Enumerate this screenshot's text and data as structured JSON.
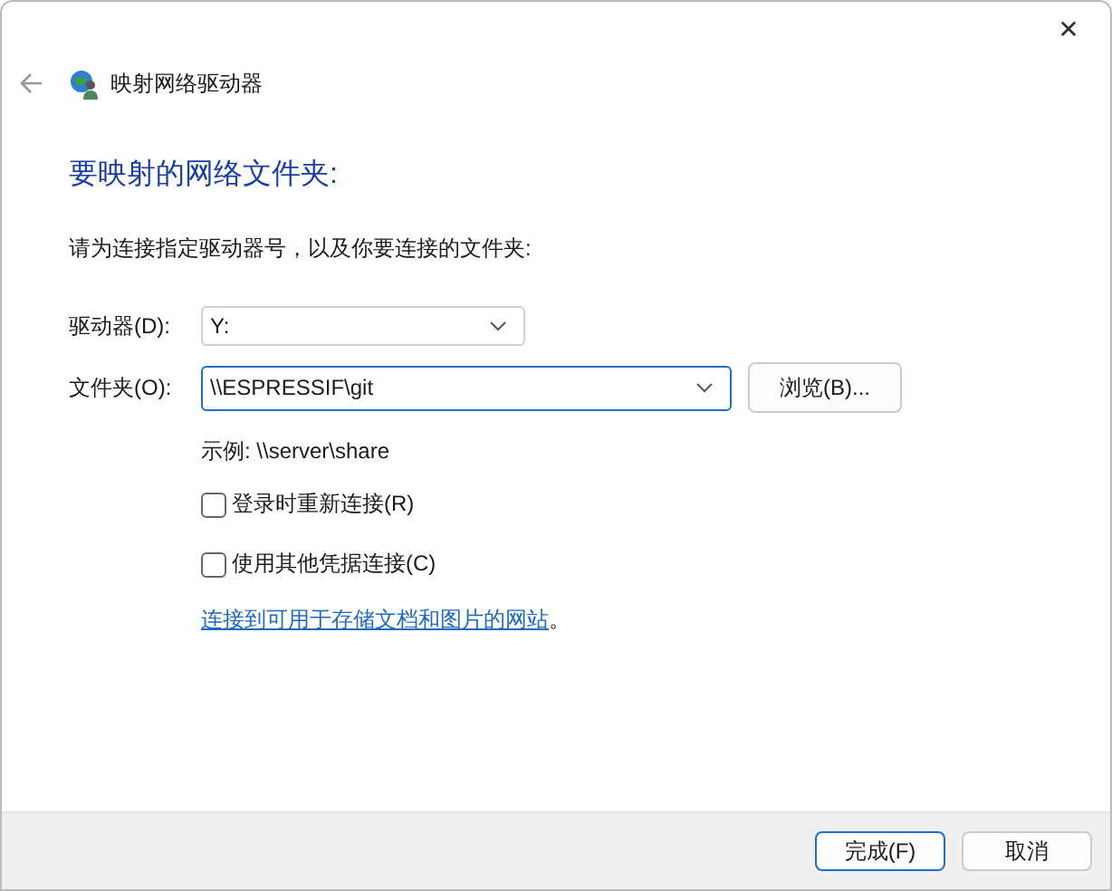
{
  "window": {
    "title": "映射网络驱动器",
    "close": "✕"
  },
  "heading": "要映射的网络文件夹:",
  "instruction": "请为连接指定驱动器号，以及你要连接的文件夹:",
  "drive": {
    "label": "驱动器(D):",
    "value": "Y:"
  },
  "folder": {
    "label": "文件夹(O):",
    "value": "\\\\ESPRESSIF\\git",
    "browse": "浏览(B)..."
  },
  "example": "示例: \\\\server\\share",
  "options": [
    {
      "label": "登录时重新连接(R)",
      "checked": false
    },
    {
      "label": "使用其他凭据连接(C)",
      "checked": false
    }
  ],
  "link": {
    "text": "连接到可用于存储文档和图片的网站",
    "suffix": "。"
  },
  "buttons": [
    {
      "label": "完成(F)",
      "default": true
    },
    {
      "label": "取消",
      "default": false
    }
  ]
}
